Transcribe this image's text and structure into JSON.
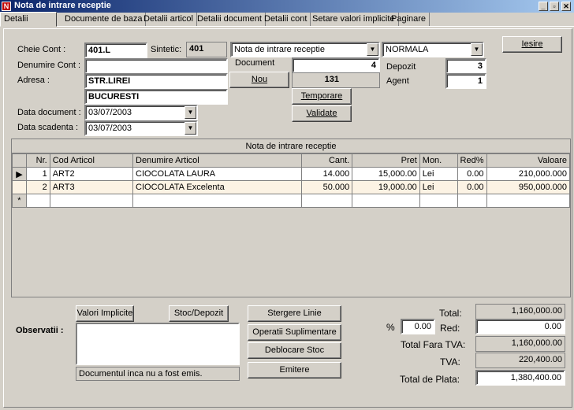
{
  "window": {
    "title": "Nota de intrare receptie",
    "icon": "document-icon"
  },
  "tabs": [
    {
      "label": "Detalii"
    },
    {
      "label": "Documente de baza"
    },
    {
      "label": "Detalii articol"
    },
    {
      "label": "Detalii document"
    },
    {
      "label": "Detalii cont"
    },
    {
      "label": "Setare valori implicite"
    },
    {
      "label": "Paginare"
    }
  ],
  "header": {
    "cheie_cont_label": "Cheie Cont :",
    "cheie_cont_value": "401.L",
    "sintetic_label": "Sintetic:",
    "sintetic_value": "401",
    "doc_type_value": "Nota de intrare receptie",
    "mode_value": "NORMALA",
    "denumire_cont_label": "Denumire Cont :",
    "denumire_cont_value": "",
    "document_label": "Document",
    "document_value": "4",
    "adresa_label": "Adresa :",
    "adresa_line1": "STR.LIREI",
    "adresa_line2": "BUCURESTI",
    "nou_label": "Nou",
    "nou_value": "131",
    "depozit_label": "Depozit",
    "depozit_value": "3",
    "agent_label": "Agent",
    "agent_value": "1",
    "temporare_label": "Temporare",
    "validate_label": "Validate",
    "data_document_label": "Data document :",
    "data_document_value": "03/07/2003",
    "data_scadenta_label": "Data scadenta :",
    "data_scadenta_value": "03/07/2003",
    "iesire_label": "Iesire"
  },
  "grid": {
    "title": "Nota de intrare receptie",
    "columns": [
      "Nr.",
      "Cod Articol",
      "Denumire Articol",
      "Cant.",
      "Pret",
      "Mon.",
      "Red%",
      "Valoare"
    ],
    "rows": [
      {
        "nr": "1",
        "cod": "ART2",
        "denumire": "CIOCOLATA LAURA",
        "cant": "14.000",
        "pret": "15,000.00",
        "mon": "Lei",
        "red": "0.00",
        "valoare": "210,000.000"
      },
      {
        "nr": "2",
        "cod": "ART3",
        "denumire": "CIOCOLATA Excelenta",
        "cant": "50.000",
        "pret": "19,000.00",
        "mon": "Lei",
        "red": "0.00",
        "valoare": "950,000.000"
      }
    ],
    "new_row_marker": "*",
    "current_row_marker": "▶"
  },
  "footer": {
    "valori_implicite_label": "Valori Implicite",
    "stoc_depozit_label": "Stoc/Depozit",
    "observatii_label": "Observatii :",
    "observatii_value": "",
    "status_text": "Documentul inca nu a fost emis.",
    "stergere_linie_label": "Stergere Linie",
    "operatii_label": "Operatii Suplimentare",
    "deblocare_label": "Deblocare Stoc",
    "emitere_label": "Emitere",
    "total_label": "Total:",
    "total_value": "1,160,000.00",
    "percent_label": "%",
    "percent_value": "0.00",
    "red_label": "Red:",
    "red_value": "0.00",
    "total_fara_tva_label": "Total Fara TVA:",
    "total_fara_tva_value": "1,160,000.00",
    "tva_label": "TVA:",
    "tva_value": "220,400.00",
    "total_plata_label": "Total de Plata:",
    "total_plata_value": "1,380,400.00"
  }
}
